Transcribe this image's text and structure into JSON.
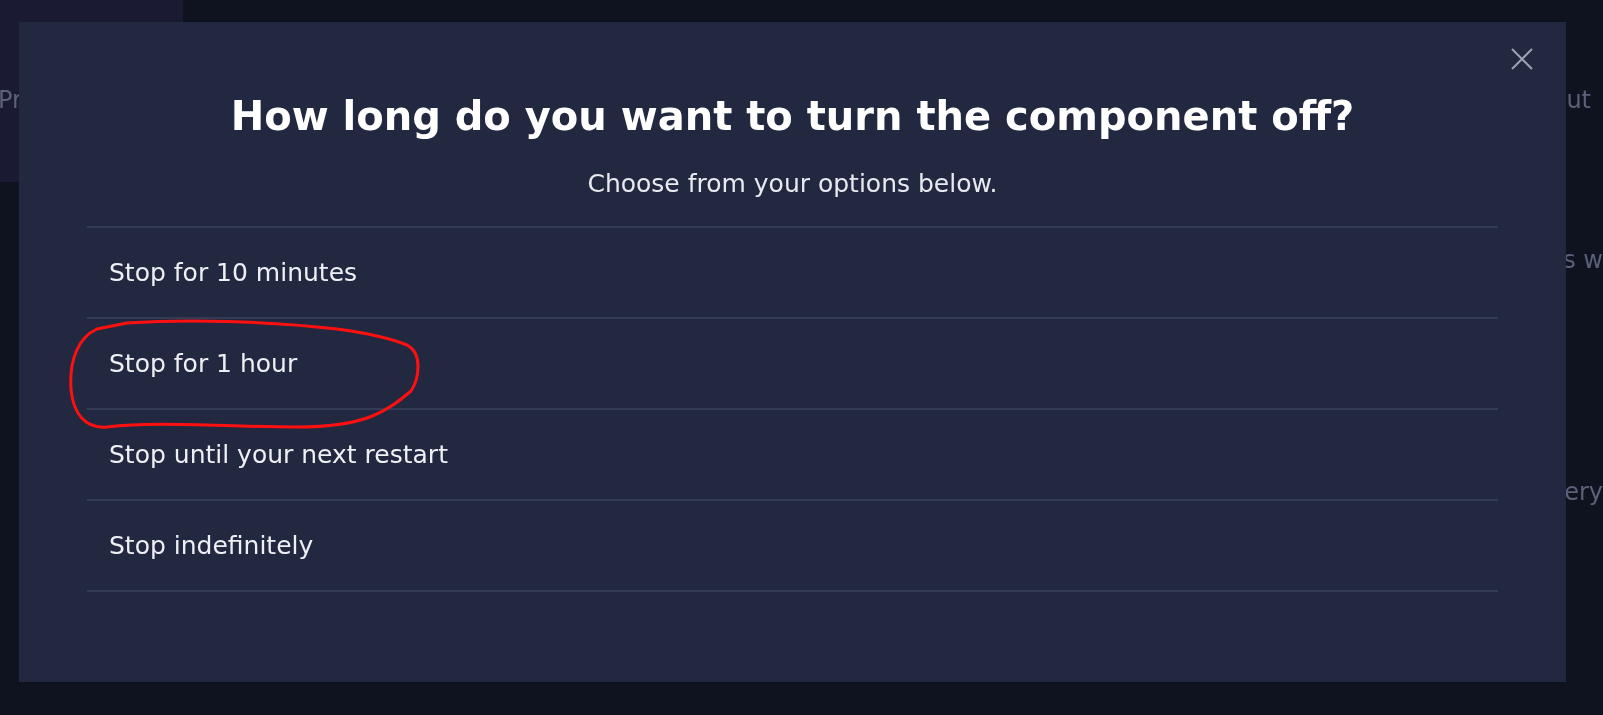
{
  "background": {
    "left_texts": [
      "Pr"
    ],
    "right_texts": [
      "ut",
      "s w",
      "ery"
    ]
  },
  "dialog": {
    "title": "How long do you want to turn the component off?",
    "subtitle": "Choose from your options below.",
    "options": [
      {
        "label": "Stop for 10 minutes",
        "circled": false
      },
      {
        "label": "Stop for 1 hour",
        "circled": true
      },
      {
        "label": "Stop until your next restart",
        "circled": false
      },
      {
        "label": "Stop indefinitely",
        "circled": false
      }
    ]
  }
}
